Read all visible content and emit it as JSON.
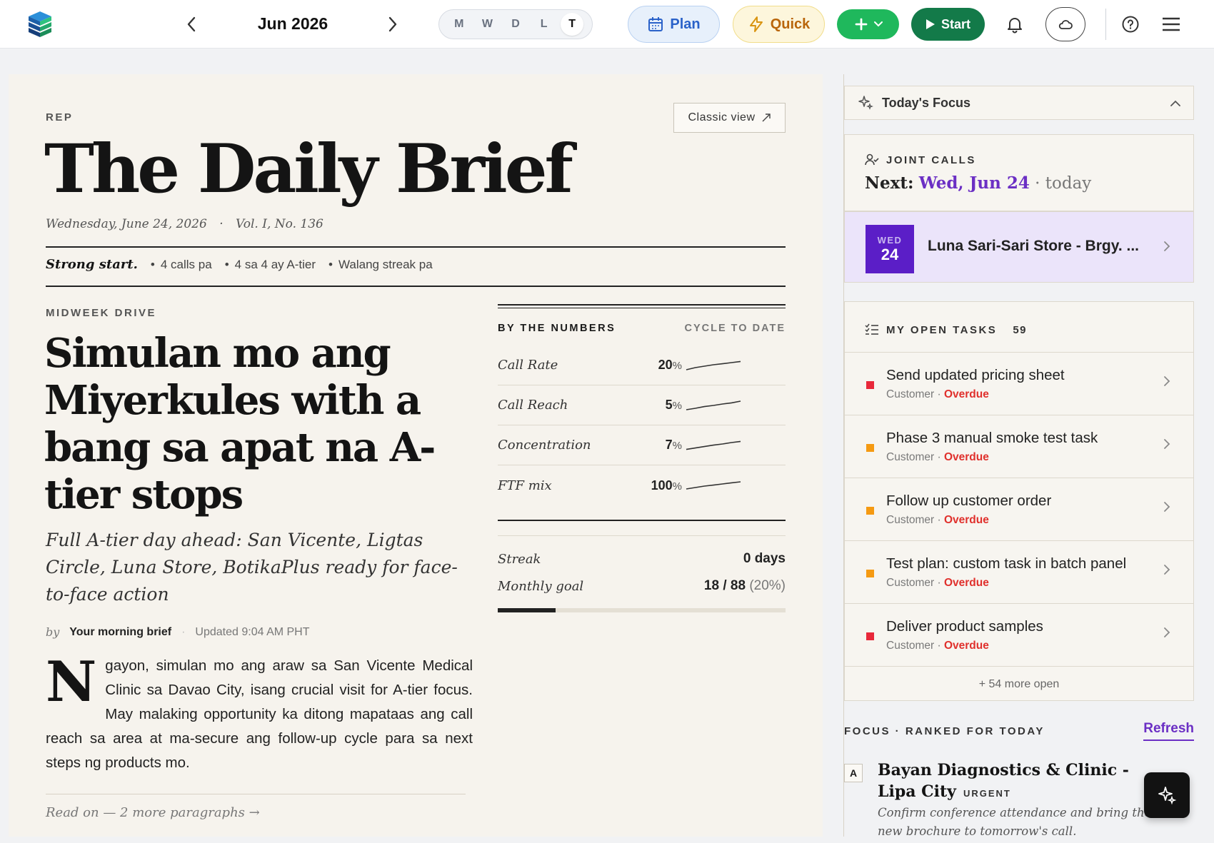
{
  "header": {
    "month": "Jun 2026",
    "views": [
      "M",
      "W",
      "D",
      "L",
      "T"
    ],
    "active_view": "T",
    "plan_label": "Plan",
    "quick_label": "Quick",
    "start_label": "Start",
    "icons": [
      "logo-icon",
      "chevron-left-icon",
      "chevron-right-icon",
      "calendar-icon",
      "lightning-icon",
      "plus-icon",
      "chevron-down-icon",
      "play-icon",
      "bell-icon",
      "cloud-icon",
      "help-icon",
      "menu-icon"
    ]
  },
  "paper": {
    "rep_kicker": "REP",
    "classic_view": "Classic view",
    "masthead": "The Daily Brief",
    "dateline": "Wednesday, June 24, 2026",
    "volume": "Vol. I, No. 136",
    "strong_start": "Strong start.",
    "highlights": [
      "4 calls pa",
      "4 sa 4 ay A-tier",
      "Walang streak pa"
    ],
    "section_kicker": "MIDWEEK DRIVE",
    "headline": "Simulan mo ang Miyerkules with a bang sa apat na A-tier stops",
    "dek": "Full A-tier day ahead: San Vicente, Ligtas Circle, Luna Store, BotikaPlus ready for face-to-face action",
    "by": "by",
    "author": "Your morning brief",
    "updated": "Updated 9:04 AM PHT",
    "dropcap": "N",
    "body": "gayon, simulan mo ang araw sa San Vicente Medical Clinic sa Davao City, isang crucial visit for A-tier focus. May malaking opportunity ka ditong mapataas ang call reach sa area at ma-secure ang follow-up cycle para sa next steps ng products mo.",
    "read_on": "Read on — 2 more paragraphs →"
  },
  "numbers": {
    "title": "BY THE NUMBERS",
    "scope": "CYCLE TO DATE",
    "rows": [
      {
        "label": "Call Rate",
        "value": "20",
        "unit": "%",
        "spark": [
          0.2,
          0.35,
          0.45,
          0.55,
          0.62,
          0.7,
          0.78
        ]
      },
      {
        "label": "Call Reach",
        "value": "5",
        "unit": "%",
        "spark": [
          0.2,
          0.3,
          0.42,
          0.5,
          0.6,
          0.68,
          0.8
        ]
      },
      {
        "label": "Concentration",
        "value": "7",
        "unit": "%",
        "spark": [
          0.22,
          0.32,
          0.42,
          0.52,
          0.6,
          0.7,
          0.78
        ]
      },
      {
        "label": "FTF mix",
        "value": "100",
        "unit": "%",
        "spark": [
          0.25,
          0.35,
          0.45,
          0.52,
          0.6,
          0.68,
          0.75
        ]
      }
    ],
    "streak_label": "Streak",
    "streak_value": "0 days",
    "goal_label": "Monthly goal",
    "goal_value": "18 / 88",
    "goal_pct": "(20%)",
    "goal_fraction": 0.2
  },
  "focus": {
    "header": "Today's Focus",
    "joint_calls_label": "JOINT CALLS",
    "next_label": "Next:",
    "next_date": "Wed, Jun 24",
    "next_suffix": "· today",
    "event_weekday": "WED",
    "event_day": "24",
    "event_name": "Luna Sari-Sari Store - Brgy. ...",
    "tasks_label": "MY OPEN TASKS",
    "tasks_count": "59",
    "tasks": [
      {
        "title": "Send updated pricing sheet",
        "type": "Customer",
        "status": "Overdue",
        "priority_color": "#e8283a"
      },
      {
        "title": "Phase 3 manual smoke test task",
        "type": "Customer",
        "status": "Overdue",
        "priority_color": "#f59a12"
      },
      {
        "title": "Follow up customer order",
        "type": "Customer",
        "status": "Overdue",
        "priority_color": "#f59a12"
      },
      {
        "title": "Test plan: custom task in batch panel",
        "type": "Customer",
        "status": "Overdue",
        "priority_color": "#f59a12"
      },
      {
        "title": "Deliver product samples",
        "type": "Customer",
        "status": "Overdue",
        "priority_color": "#e8283a"
      }
    ],
    "more_open": "+ 54 more open",
    "ranked_label": "FOCUS · RANKED FOR TODAY",
    "refresh": "Refresh",
    "top_rank_tier": "A",
    "top_rank_name": "Bayan Diagnostics & Clinic - Lipa City",
    "top_rank_tag": "URGENT",
    "top_rank_desc": "Confirm conference attendance and bring the new brochure to tomorrow's call."
  },
  "colors": {
    "accent_purple": "#6b2fc4",
    "start_green": "#137a49",
    "add_green": "#1fb85c",
    "overdue_red": "#e0302c",
    "paper_bg": "#f6f3ed"
  }
}
